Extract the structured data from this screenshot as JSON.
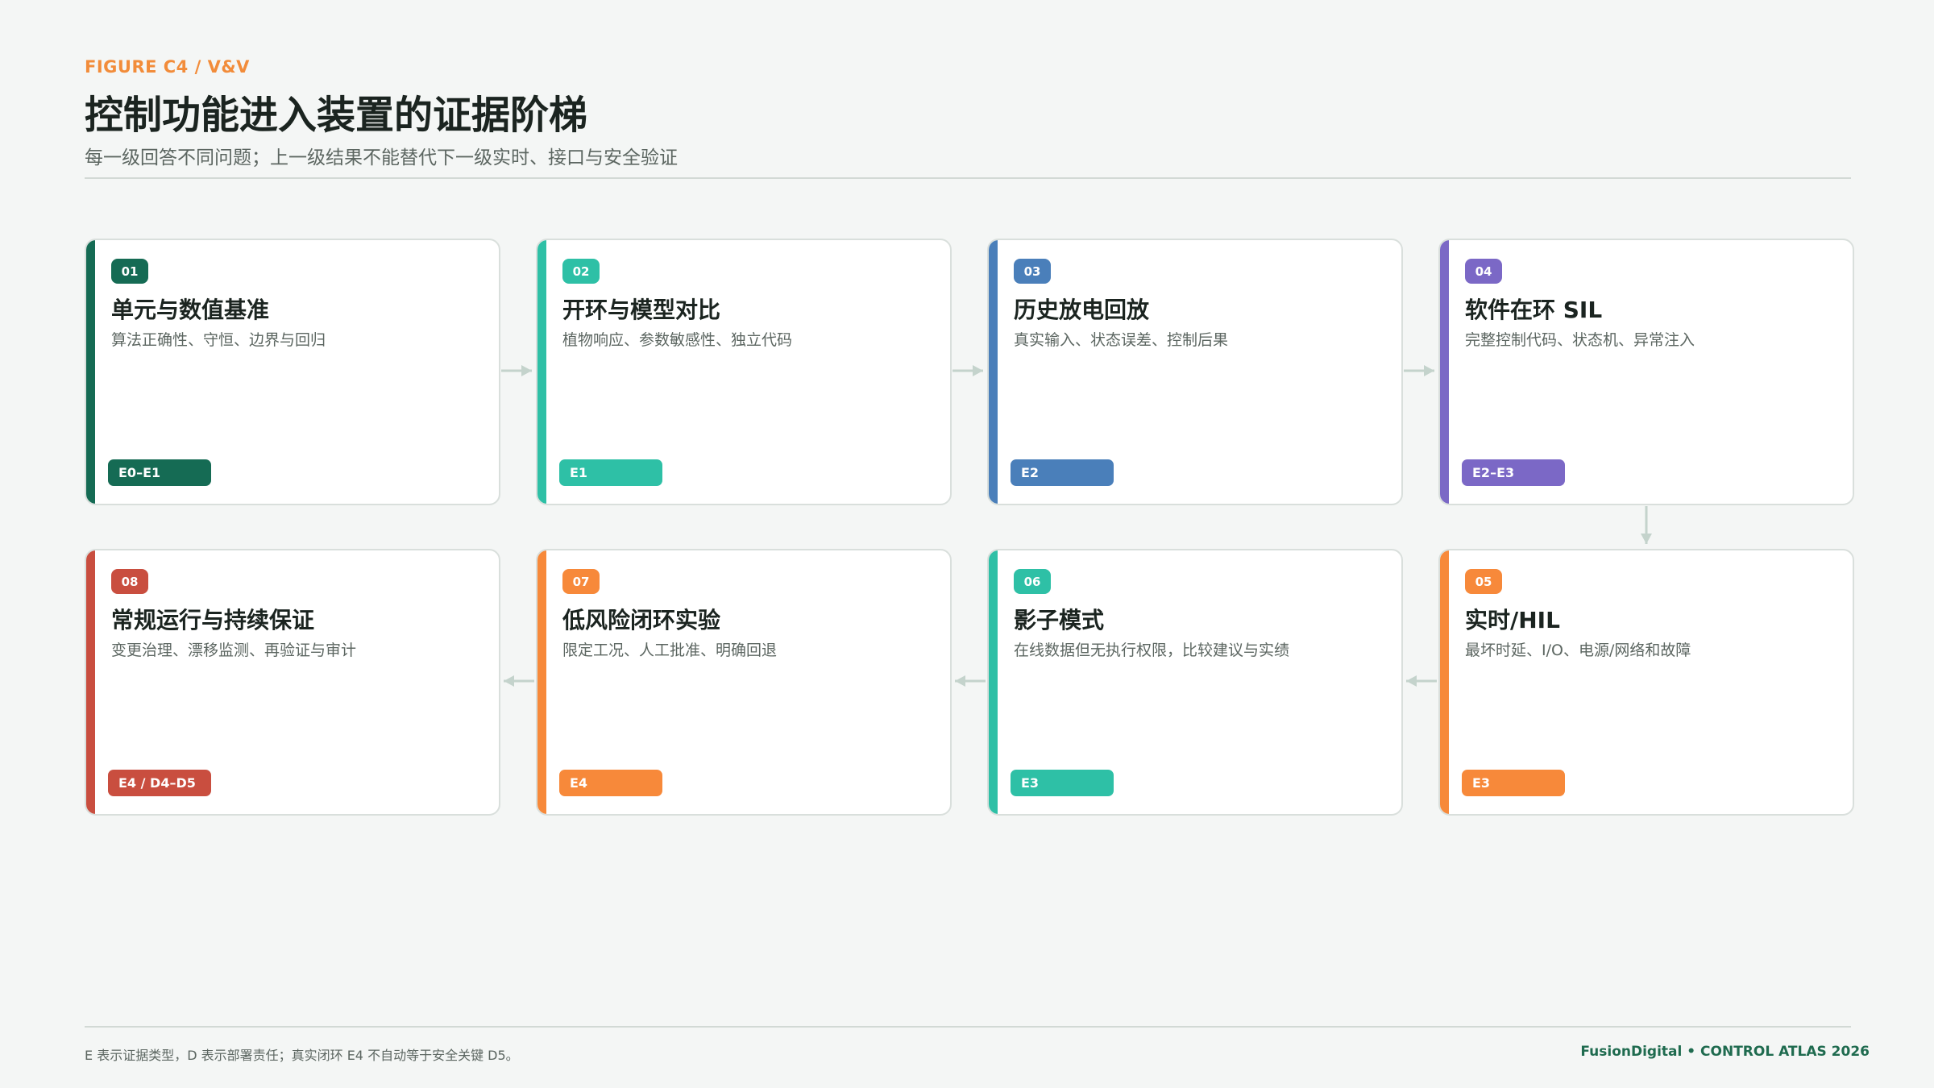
{
  "header": {
    "kicker": "FIGURE C4 / V&V",
    "title": "控制功能进入装置的证据阶梯",
    "subtitle": "每一级回答不同问题；上一级结果不能替代下一级实时、接口与安全验证"
  },
  "steps": [
    {
      "num": "01",
      "title": "单元与数值基准",
      "desc": "算法正确性、守恒、边界与回归",
      "level": "E0–E1",
      "color": "#156b54"
    },
    {
      "num": "02",
      "title": "开环与模型对比",
      "desc": "植物响应、参数敏感性、独立代码",
      "level": "E1",
      "color": "#2ec0a6"
    },
    {
      "num": "03",
      "title": "历史放电回放",
      "desc": "真实输入、状态误差、控制后果",
      "level": "E2",
      "color": "#4a7fba"
    },
    {
      "num": "04",
      "title": "软件在环 SIL",
      "desc": "完整控制代码、状态机、异常注入",
      "level": "E2–E3",
      "color": "#7b68c6"
    },
    {
      "num": "05",
      "title": "实时/HIL",
      "desc": "最坏时延、I/O、电源/网络和故障",
      "level": "E3",
      "color": "#f7893a"
    },
    {
      "num": "06",
      "title": "影子模式",
      "desc": "在线数据但无执行权限，比较建议与实绩",
      "level": "E3",
      "color": "#2ec0a6"
    },
    {
      "num": "07",
      "title": "低风险闭环实验",
      "desc": "限定工况、人工批准、明确回退",
      "level": "E4",
      "color": "#f7893a"
    },
    {
      "num": "08",
      "title": "常规运行与持续保证",
      "desc": "变更治理、漂移监测、再验证与审计",
      "level": "E4 / D4–D5",
      "color": "#c94e3f"
    }
  ],
  "footer": {
    "note": "E 表示证据类型，D 表示部署责任；真实闭环 E4 不自动等于安全关键 D5。",
    "brand": "FusionDigital • CONTROL ATLAS 2026"
  },
  "arrow_color": "#c4d3cc"
}
